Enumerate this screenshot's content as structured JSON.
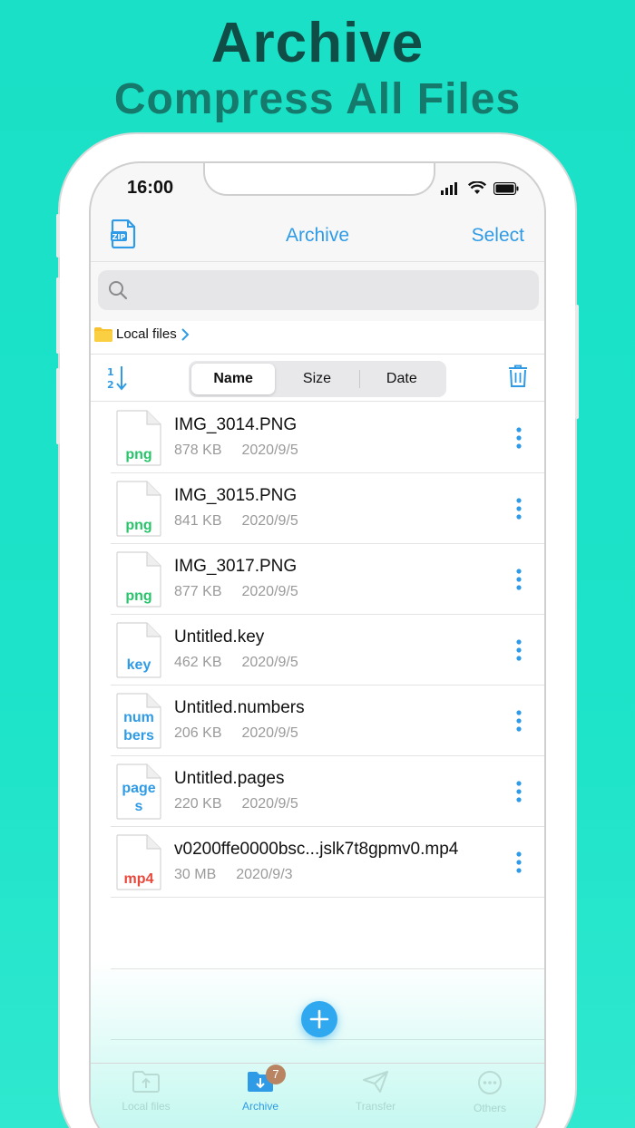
{
  "promo": {
    "title": "Archive",
    "subtitle": "Compress All Files"
  },
  "status_bar": {
    "time": "16:00"
  },
  "nav": {
    "title": "Archive",
    "select_label": "Select",
    "zip_icon": "zip-file-icon"
  },
  "search": {
    "placeholder": ""
  },
  "breadcrumb": {
    "label": "Local files"
  },
  "sort": {
    "options": [
      "Name",
      "Size",
      "Date"
    ],
    "selected": "Name"
  },
  "files": [
    {
      "name": "IMG_3014.PNG",
      "size": "878 KB",
      "date": "2020/9/5",
      "ext_lines": [
        "png"
      ],
      "ext_color": "#27c46a"
    },
    {
      "name": "IMG_3015.PNG",
      "size": "841 KB",
      "date": "2020/9/5",
      "ext_lines": [
        "png"
      ],
      "ext_color": "#27c46a"
    },
    {
      "name": "IMG_3017.PNG",
      "size": "877 KB",
      "date": "2020/9/5",
      "ext_lines": [
        "png"
      ],
      "ext_color": "#27c46a"
    },
    {
      "name": "Untitled.key",
      "size": "462 KB",
      "date": "2020/9/5",
      "ext_lines": [
        "key"
      ],
      "ext_color": "#2f9be6"
    },
    {
      "name": "Untitled.numbers",
      "size": "206 KB",
      "date": "2020/9/5",
      "ext_lines": [
        "num",
        "bers"
      ],
      "ext_color": "#2f9be6"
    },
    {
      "name": "Untitled.pages",
      "size": "220 KB",
      "date": "2020/9/5",
      "ext_lines": [
        "page",
        "s"
      ],
      "ext_color": "#2f9be6"
    },
    {
      "name": "v0200ffe0000bsc...jslk7t8gpmv0.mp4",
      "size": "30 MB",
      "date": "2020/9/3",
      "ext_lines": [
        "mp4"
      ],
      "ext_color": "#e8473a"
    }
  ],
  "tabs": [
    {
      "label": "Local files",
      "icon": "folder-upload-icon",
      "active": false
    },
    {
      "label": "Archive",
      "icon": "folder-download-icon",
      "active": true,
      "badge": "7"
    },
    {
      "label": "Transfer",
      "icon": "paper-plane-icon",
      "active": false
    },
    {
      "label": "Others",
      "icon": "more-circle-icon",
      "active": false
    }
  ],
  "colors": {
    "accent": "#2f9be6",
    "background": "#1ce3c9",
    "badge": "#b98462"
  }
}
